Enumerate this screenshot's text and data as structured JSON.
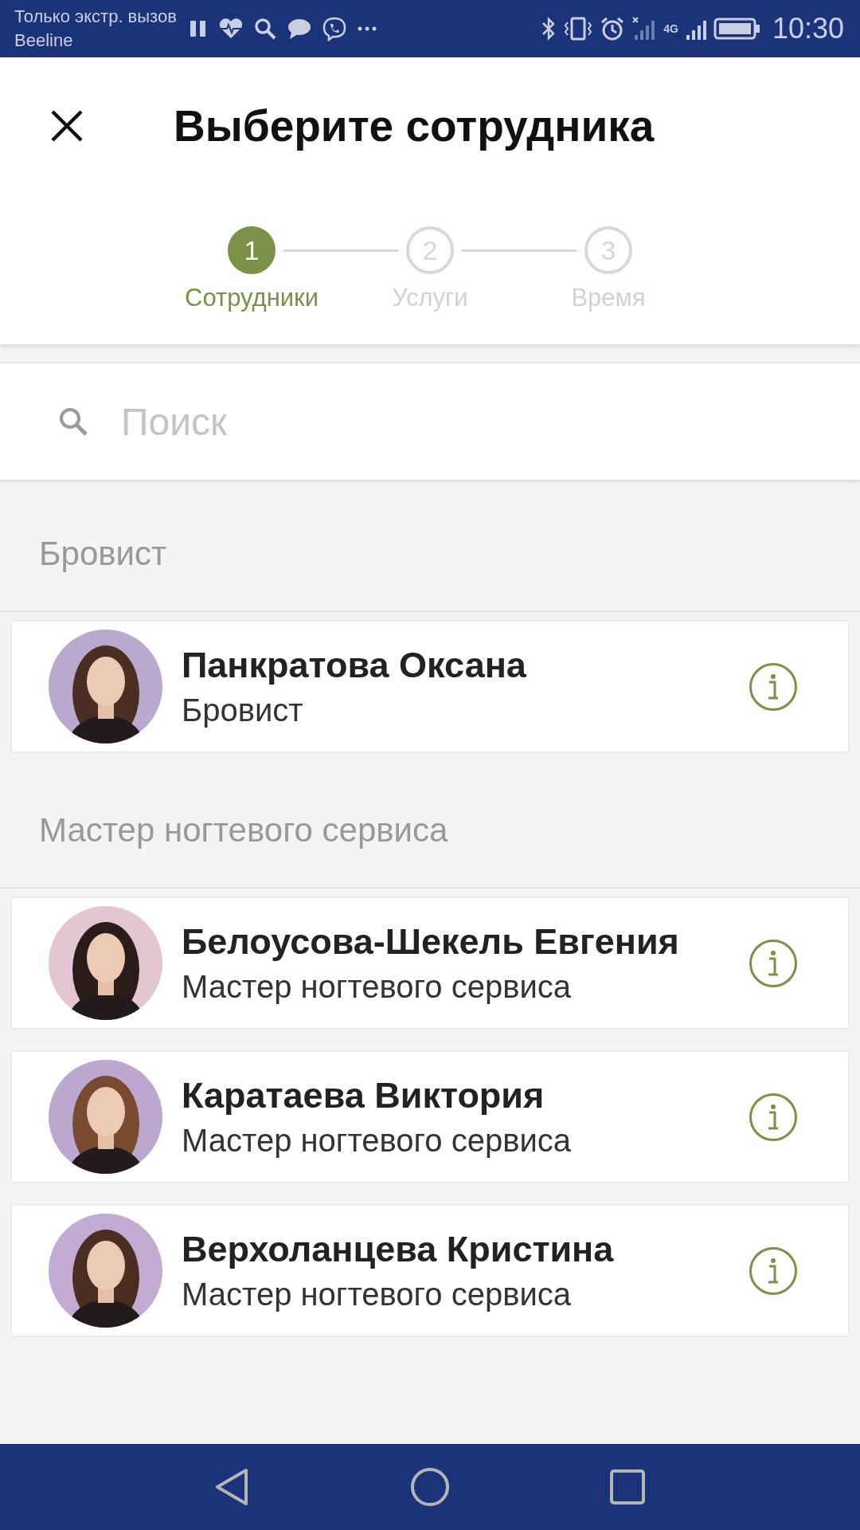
{
  "status_bar": {
    "carrier_line_1": "Только экстр. вызов",
    "carrier_line_2": "Beeline",
    "network": "4G",
    "time": "10:30"
  },
  "header": {
    "title": "Выберите сотрудника"
  },
  "steps": [
    {
      "number": "1",
      "label": "Сотрудники",
      "selected": true
    },
    {
      "number": "2",
      "label": "Услуги",
      "selected": false
    },
    {
      "number": "3",
      "label": "Время",
      "selected": false
    }
  ],
  "search": {
    "placeholder": "Поиск"
  },
  "sections": [
    {
      "title": "Бровист",
      "employees": [
        {
          "name": "Панкратова Оксана",
          "role": "Бровист"
        }
      ]
    },
    {
      "title": "Мастер ногтевого сервиса",
      "employees": [
        {
          "name": "Белоусова-Шекель Евгения",
          "role": "Мастер ногтевого сервиса"
        },
        {
          "name": "Каратаева Виктория",
          "role": "Мастер ногтевого сервиса"
        },
        {
          "name": "Верхоланцева Кристина",
          "role": "Мастер ногтевого сервиса"
        }
      ]
    }
  ]
}
